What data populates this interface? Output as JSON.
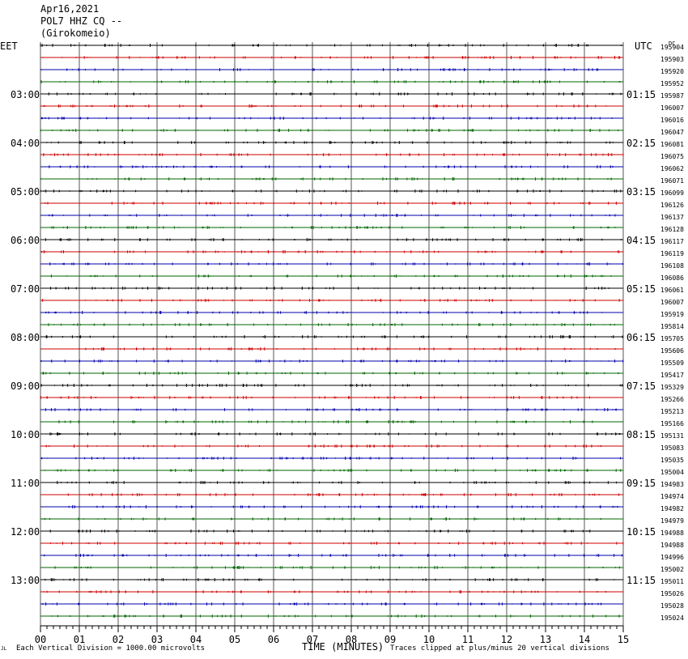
{
  "header": {
    "date": "Apr16,2021",
    "station": "POL7 HHZ CQ --",
    "location": "(Girokomeio)"
  },
  "left_header": "EET",
  "right_header": "UTC",
  "footer": {
    "scale": "Each Vertical Division = 1000.00 microvolts",
    "xlabel": "TIME (MINUTES)",
    "clip": "Traces clipped at plus/minus 20 vertical divisions",
    "mark": "JL"
  },
  "colors": {
    "cycle": [
      "#000000",
      "#cc0000",
      "#0000aa",
      "#006600"
    ],
    "grid": "#555555"
  },
  "chart_data": {
    "type": "line",
    "x_range": [
      0,
      15
    ],
    "x_ticks": [
      "00",
      "01",
      "02",
      "03",
      "04",
      "05",
      "06",
      "07",
      "08",
      "09",
      "10",
      "11",
      "12",
      "13",
      "14",
      "15"
    ],
    "rows": 48,
    "left_time_labels": [
      {
        "row": 4,
        "text": "03:00"
      },
      {
        "row": 8,
        "text": "04:00"
      },
      {
        "row": 12,
        "text": "05:00"
      },
      {
        "row": 16,
        "text": "06:00"
      },
      {
        "row": 20,
        "text": "07:00"
      },
      {
        "row": 24,
        "text": "08:00"
      },
      {
        "row": 28,
        "text": "09:00"
      },
      {
        "row": 32,
        "text": "10:00"
      },
      {
        "row": 36,
        "text": "11:00"
      },
      {
        "row": 40,
        "text": "12:00"
      },
      {
        "row": 44,
        "text": "13:00"
      }
    ],
    "right_time_labels": [
      {
        "row": 4,
        "text": "01:15"
      },
      {
        "row": 8,
        "text": "02:15"
      },
      {
        "row": 12,
        "text": "03:15"
      },
      {
        "row": 16,
        "text": "04:15"
      },
      {
        "row": 20,
        "text": "05:15"
      },
      {
        "row": 24,
        "text": "06:15"
      },
      {
        "row": 28,
        "text": "07:15"
      },
      {
        "row": 32,
        "text": "08:15"
      },
      {
        "row": 36,
        "text": "09:15"
      },
      {
        "row": 40,
        "text": "10:15"
      },
      {
        "row": 44,
        "text": "11:15"
      }
    ],
    "row_values": [
      "195904",
      "195903",
      "195920",
      "195952",
      "195987",
      "196007",
      "196016",
      "196047",
      "196081",
      "196075",
      "196062",
      "196071",
      "196099",
      "196126",
      "196137",
      "196128",
      "196117",
      "196119",
      "196108",
      "196086",
      "196061",
      "196007",
      "195919",
      "195814",
      "195705",
      "195606",
      "195509",
      "195417",
      "195329",
      "195266",
      "195213",
      "195166",
      "195131",
      "195083",
      "195035",
      "195004",
      "194983",
      "194974",
      "194982",
      "194979",
      "194988",
      "194988",
      "194996",
      "195002",
      "195011",
      "195026",
      "195028",
      "195024"
    ],
    "first_row_small_label": "DC"
  }
}
